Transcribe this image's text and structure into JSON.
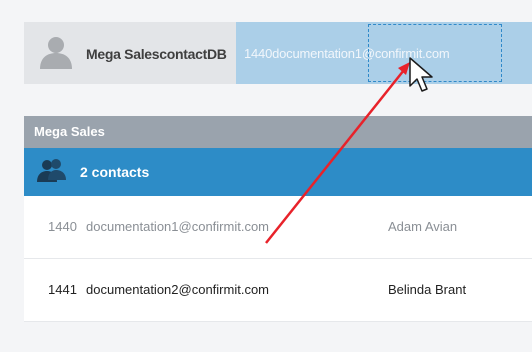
{
  "dropbar": {
    "label": "Mega SalescontactDB",
    "ghost_text": "1440documentation1@confirmit.com"
  },
  "panel": {
    "title": "Mega Sales",
    "group": {
      "label": "2 contacts"
    },
    "rows": [
      {
        "id": "1440",
        "email": "documentation1@confirmit.com",
        "name": "Adam Avian"
      },
      {
        "id": "1441",
        "email": "documentation2@confirmit.com",
        "name": "Belinda Brant"
      }
    ]
  },
  "icons": {
    "dropbar_person": "person-icon",
    "group_people": "people-group-icon",
    "cursor": "cursor-icon",
    "arrow": "drag-arrow"
  },
  "colors": {
    "header_gray": "#9aa3ad",
    "group_blue": "#2d8cc7",
    "ghost_blue": "#7dbee8",
    "arrow_red": "#e8222a"
  }
}
